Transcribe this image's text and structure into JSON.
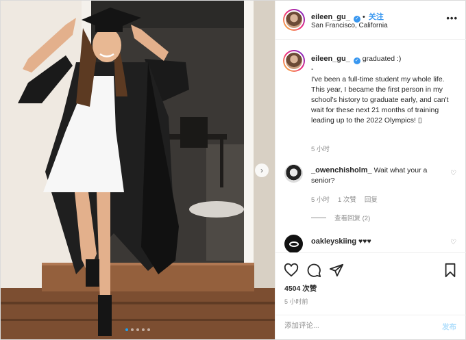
{
  "post": {
    "author": {
      "username": "eileen_gu_",
      "follow_label": "关注",
      "location": "San Francisco, California"
    },
    "more_icon": "more-dots-icon",
    "caption": {
      "username": "eileen_gu_",
      "text": "graduated :)\n-\nI've been a full-time student my whole life. This year, I became the first person in my school's history to graduate early, and can't wait for these next 21 months of training leading up to the 2022 Olympics! ▯",
      "time": "5 小时"
    },
    "comments": [
      {
        "username": "_owenchisholm_",
        "text": "Wait what your a senior?",
        "time": "5 小时",
        "likes": "1 次赞",
        "reply": "回复",
        "view_replies": "查看回复 (2)"
      },
      {
        "username": "oakleyskiing",
        "text": "♥♥♥"
      }
    ],
    "likes": "4504 次赞",
    "posted_ago": "5 小时前",
    "comment_placeholder": "添加评论...",
    "post_label": "发布",
    "carousel": {
      "slides": 5,
      "active": 1,
      "next_icon": "chevron-right-icon"
    },
    "colors": {
      "link": "#3897f0",
      "dot_active": "#1da1f2",
      "post_disabled": "#b2dffc"
    }
  }
}
